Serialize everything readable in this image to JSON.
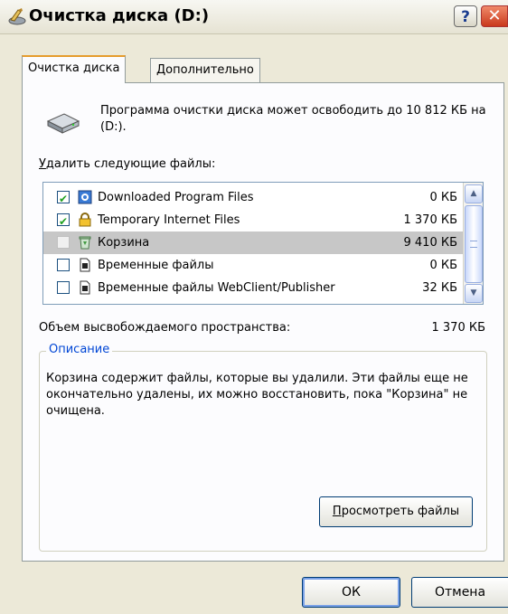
{
  "window": {
    "title": "Очистка диска  (D:)",
    "help_label": "?",
    "close_label": "✕"
  },
  "tabs": [
    {
      "label": "Очистка диска",
      "active": true
    },
    {
      "label": "Дополнительно",
      "active": false
    }
  ],
  "main": {
    "info_text": "Программа очистки диска может освободить до 10 812 КБ на  (D:).",
    "list_label_accel": "У",
    "list_label_rest": "далить следующие файлы:",
    "files": [
      {
        "name": "Downloaded Program Files",
        "size": "0 КБ",
        "checked": true,
        "icon": "activex-icon"
      },
      {
        "name": "Temporary Internet Files",
        "size": "1 370 КБ",
        "checked": true,
        "icon": "lock-icon"
      },
      {
        "name": "Корзина",
        "size": "9 410 КБ",
        "checked": false,
        "icon": "recycle-bin-icon"
      },
      {
        "name": "Временные файлы",
        "size": "0 КБ",
        "checked": false,
        "icon": "document-icon"
      },
      {
        "name": "Временные файлы WebClient/Publisher",
        "size": "32 КБ",
        "checked": false,
        "icon": "document-icon"
      }
    ],
    "space_label": "Объем высвобождаемого пространства:",
    "space_value": "1 370 КБ",
    "description_legend": "Описание",
    "description_text": "Корзина содержит файлы, которые вы удалили. Эти файлы еще не окончательно удалены, их можно восстановить, пока \"Корзина\" не очищена.",
    "view_files_accel": "П",
    "view_files_rest": "росмотреть файлы"
  },
  "footer": {
    "ok_label": "ОК",
    "cancel_label": "Отмена"
  },
  "colors": {
    "window_bg": "#ece9d8",
    "panel_bg": "#fcfcfe",
    "accent_tab": "#e69c2c",
    "legend_blue": "#0046d5",
    "selected_row": "#c7c7c7"
  }
}
